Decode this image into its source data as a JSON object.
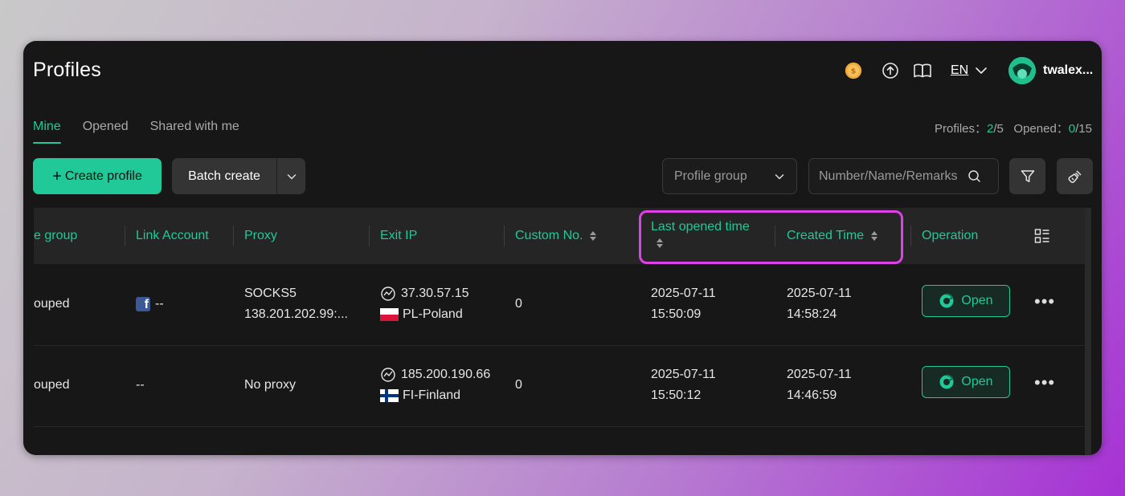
{
  "header": {
    "title": "Profiles",
    "lang": "EN",
    "username": "twalex...",
    "icons": [
      "coin-icon",
      "upload-icon",
      "book-icon",
      "chevron-down-icon",
      "avatar"
    ]
  },
  "tabs": [
    {
      "label": "Mine",
      "active": true
    },
    {
      "label": "Opened",
      "active": false
    },
    {
      "label": "Shared with me",
      "active": false
    }
  ],
  "counts": {
    "profiles_label": "Profiles：",
    "profiles_used": "2",
    "profiles_total": "/5",
    "opened_label": "Opened：",
    "opened_used": "0",
    "opened_total": "/15"
  },
  "toolbar": {
    "create_label": "Create profile",
    "batch_label": "Batch create",
    "group_placeholder": "Profile group",
    "search_placeholder": "Number/Name/Remarks"
  },
  "table": {
    "columns": {
      "group": "e group",
      "link_account": "Link Account",
      "proxy": "Proxy",
      "exit_ip": "Exit IP",
      "custom_no": "Custom No.",
      "last_opened": "Last opened time",
      "created": "Created Time",
      "operation": "Operation"
    },
    "rows": [
      {
        "group": "ouped",
        "link_account": "--",
        "link_icon": "facebook-icon",
        "proxy_line1": "SOCKS5",
        "proxy_line2": "138.201.202.99:...",
        "exit_ip": "37.30.57.15",
        "country": "PL-Poland",
        "custom_no": "0",
        "last_opened_date": "2025-07-11",
        "last_opened_time": "15:50:09",
        "created_date": "2025-07-11",
        "created_time": "14:58:24",
        "open_label": "Open"
      },
      {
        "group": "ouped",
        "link_account": "--",
        "proxy_line1": "No proxy",
        "exit_ip": "185.200.190.66",
        "country": "FI-Finland",
        "custom_no": "0",
        "last_opened_date": "2025-07-11",
        "last_opened_time": "15:50:12",
        "created_date": "2025-07-11",
        "created_time": "14:46:59",
        "open_label": "Open"
      }
    ]
  },
  "colors": {
    "accent": "#20c997",
    "highlight": "#e040e8",
    "background": "#171717"
  }
}
